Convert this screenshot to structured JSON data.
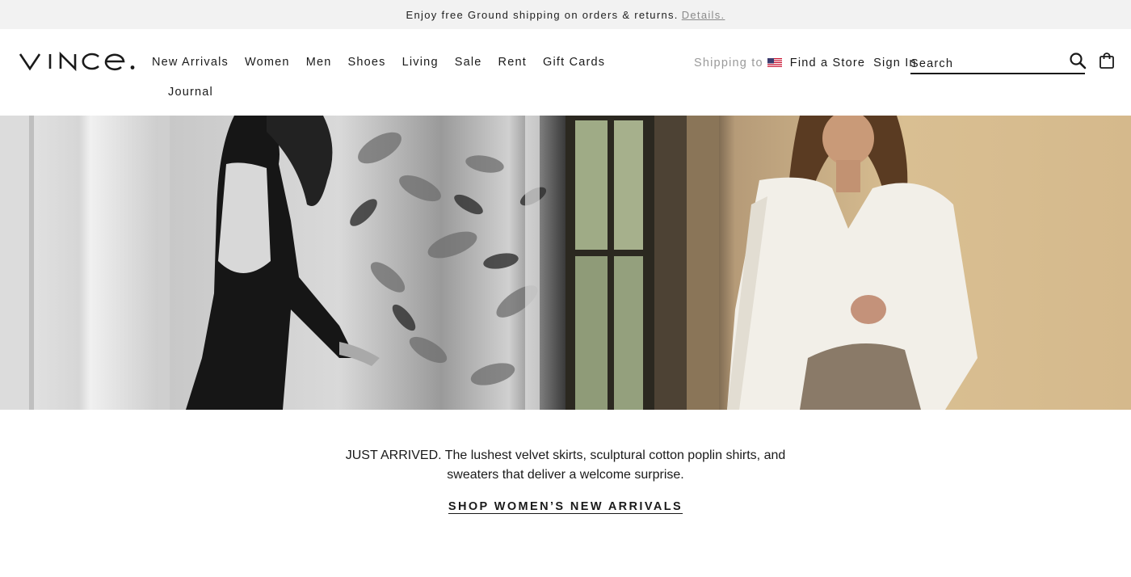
{
  "promo": {
    "text": "Enjoy free Ground shipping on orders & returns.",
    "link": "Details."
  },
  "header": {
    "logo": "VINCE.",
    "nav": [
      "New Arrivals",
      "Women",
      "Men",
      "Shoes",
      "Living",
      "Sale",
      "Rent",
      "Gift Cards"
    ],
    "nav_row2": "Journal",
    "shipping_label": "Shipping to",
    "shipping_flag": "us-flag-icon",
    "find_store": "Find a Store",
    "sign_in": "Sign In",
    "search_placeholder": "Search",
    "icons": {
      "search": "search-icon",
      "bag": "shopping-bag-icon"
    }
  },
  "hero": {
    "left_image": "black-and-white photo of woman in open-back black dress beside foliage",
    "right_image": "color photo of woman in white shirt and metallic velvet skirt against beige wall"
  },
  "copy": {
    "text": "JUST ARRIVED. The lushest velvet skirts, sculptural cotton poplin shirts, and sweaters that deliver a welcome surprise.",
    "cta": "SHOP WOMEN’S NEW ARRIVALS"
  },
  "colors": {
    "promo_bg": "#f2f2f2",
    "text": "#1a1a1a",
    "muted": "#9a9a9a"
  }
}
